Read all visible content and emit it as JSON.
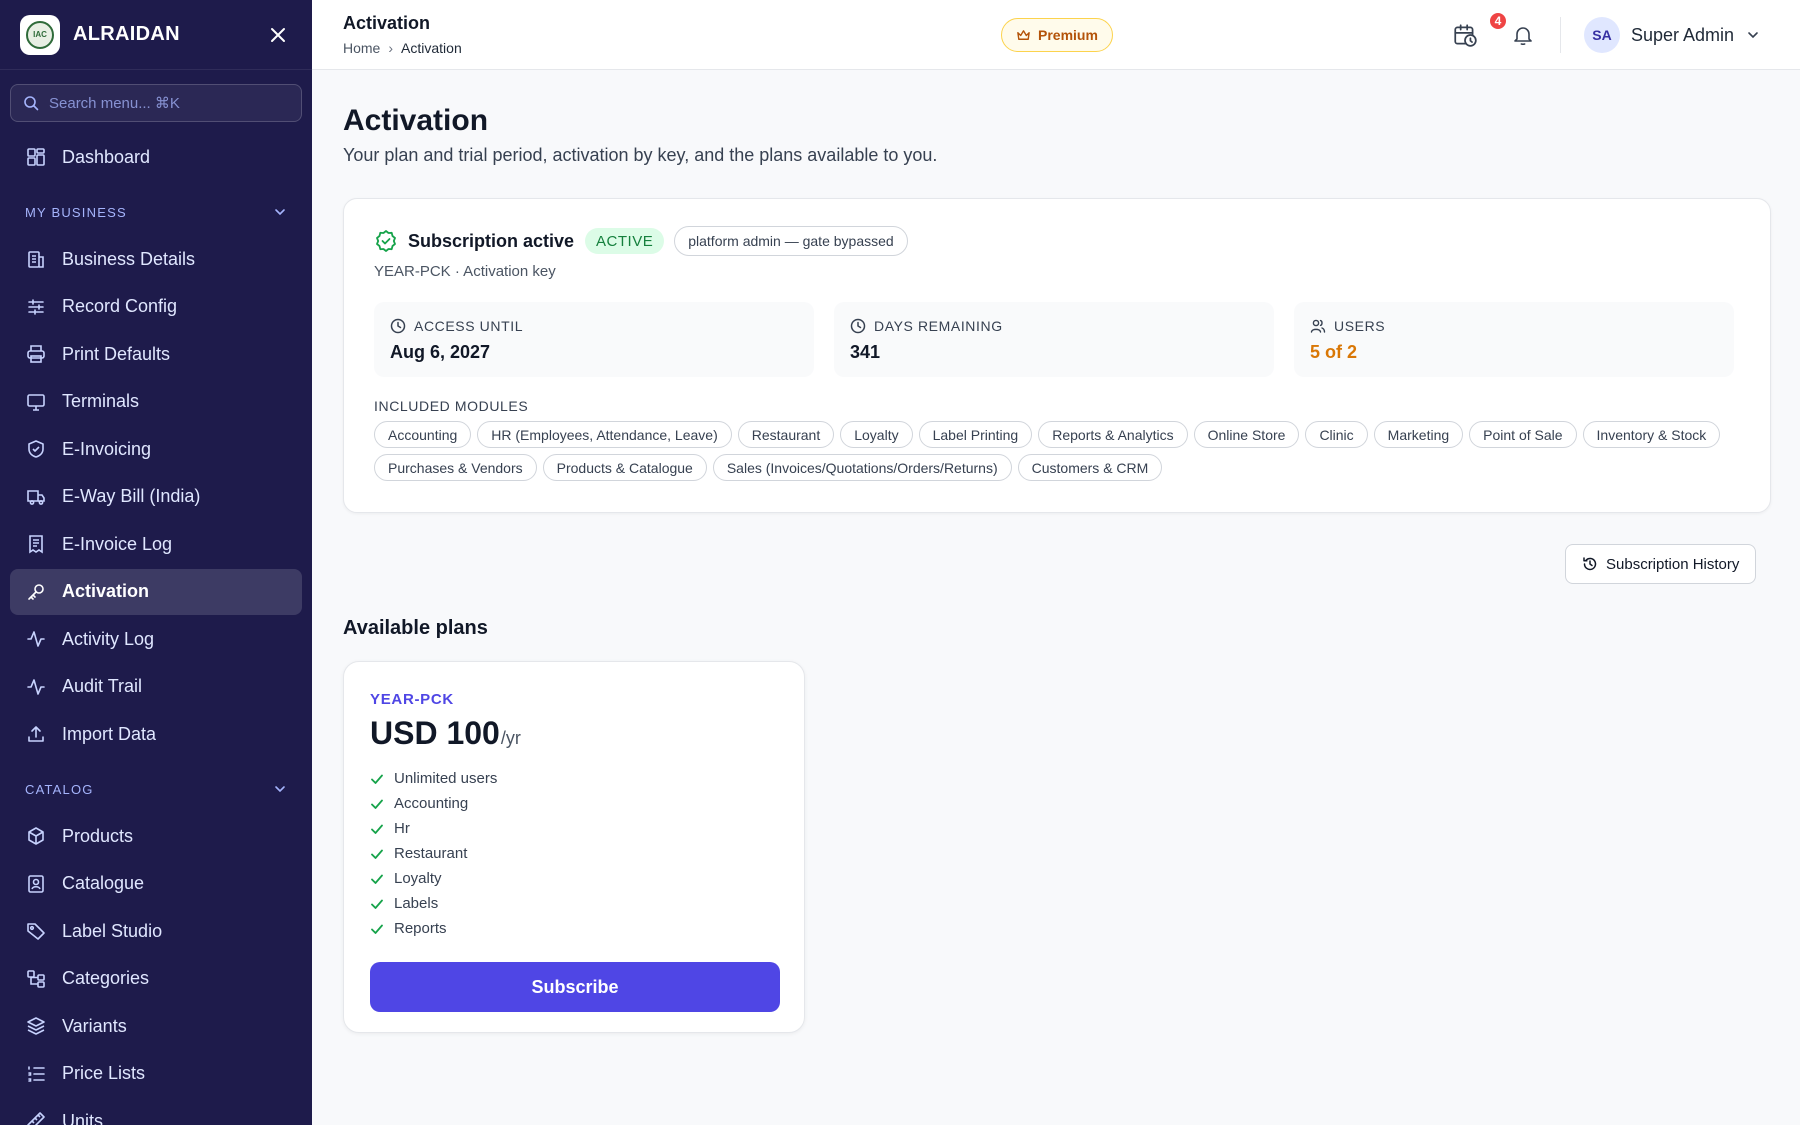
{
  "sidebar": {
    "brand": "ALRAIDAN",
    "logo_text": "IAC",
    "search_placeholder": "Search menu... ⌘K",
    "dashboard": {
      "label": "Dashboard",
      "icon": "dashboard-icon"
    },
    "sections": [
      {
        "label": "MY BUSINESS",
        "items": [
          {
            "label": "Business Details",
            "icon": "building-icon"
          },
          {
            "label": "Record Config",
            "icon": "sliders-icon"
          },
          {
            "label": "Print Defaults",
            "icon": "printer-icon"
          },
          {
            "label": "Terminals",
            "icon": "monitor-icon"
          },
          {
            "label": "E-Invoicing",
            "icon": "shield-icon"
          },
          {
            "label": "E-Way Bill (India)",
            "icon": "truck-icon"
          },
          {
            "label": "E-Invoice Log",
            "icon": "receipt-icon"
          },
          {
            "label": "Activation",
            "icon": "key-icon",
            "active": true
          },
          {
            "label": "Activity Log",
            "icon": "activity-icon"
          },
          {
            "label": "Audit Trail",
            "icon": "activity-icon"
          },
          {
            "label": "Import Data",
            "icon": "upload-icon"
          }
        ]
      },
      {
        "label": "CATALOG",
        "items": [
          {
            "label": "Products",
            "icon": "box-icon"
          },
          {
            "label": "Catalogue",
            "icon": "image-icon"
          },
          {
            "label": "Label Studio",
            "icon": "tag-icon"
          },
          {
            "label": "Categories",
            "icon": "categories-icon"
          },
          {
            "label": "Variants",
            "icon": "layers-icon"
          },
          {
            "label": "Price Lists",
            "icon": "list-icon"
          },
          {
            "label": "Units",
            "icon": "ruler-icon"
          }
        ]
      }
    ]
  },
  "topbar": {
    "title": "Activation",
    "breadcrumb_home": "Home",
    "breadcrumb_current": "Activation",
    "premium_label": "Premium",
    "notification_count": "4",
    "user_initials": "SA",
    "user_name": "Super Admin"
  },
  "page": {
    "title": "Activation",
    "subtitle": "Your plan and trial period, activation by key, and the plans available to you."
  },
  "subscription": {
    "title": "Subscription active",
    "status": "ACTIVE",
    "note": "platform admin — gate bypassed",
    "plan_key": "YEAR-PCK · Activation key",
    "stats": [
      {
        "label": "ACCESS UNTIL",
        "value": "Aug 6, 2027",
        "icon": "clock-icon"
      },
      {
        "label": "DAYS REMAINING",
        "value": "341",
        "icon": "clock-icon"
      },
      {
        "label": "USERS",
        "value": "5 of 2",
        "icon": "users-icon",
        "warn": true
      }
    ],
    "modules_label": "INCLUDED MODULES",
    "modules": [
      "Accounting",
      "HR (Employees, Attendance, Leave)",
      "Restaurant",
      "Loyalty",
      "Label Printing",
      "Reports & Analytics",
      "Online Store",
      "Clinic",
      "Marketing",
      "Point of Sale",
      "Inventory & Stock",
      "Purchases & Vendors",
      "Products & Catalogue",
      "Sales (Invoices/Quotations/Orders/Returns)",
      "Customers & CRM"
    ]
  },
  "history_button": "Subscription History",
  "plans": {
    "heading": "Available plans",
    "items": [
      {
        "code": "YEAR-PCK",
        "price": "USD 100",
        "period": "/yr",
        "features": [
          "Unlimited users",
          "Accounting",
          "Hr",
          "Restaurant",
          "Loyalty",
          "Labels",
          "Reports"
        ],
        "cta": "Subscribe"
      }
    ]
  },
  "colors": {
    "sidebar_bg": "#1e1b4b",
    "accent": "#4f46e5",
    "active_green": "#15803d",
    "warn_orange": "#d97706",
    "premium_gold": "#b45309",
    "badge_red": "#ef4444"
  }
}
